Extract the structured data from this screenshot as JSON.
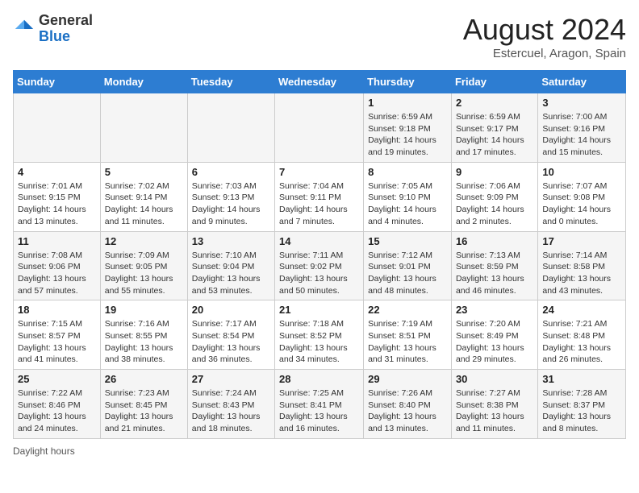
{
  "header": {
    "logo_general": "General",
    "logo_blue": "Blue",
    "month_year": "August 2024",
    "location": "Estercuel, Aragon, Spain"
  },
  "weekdays": [
    "Sunday",
    "Monday",
    "Tuesday",
    "Wednesday",
    "Thursday",
    "Friday",
    "Saturday"
  ],
  "weeks": [
    [
      {
        "day": "",
        "info": ""
      },
      {
        "day": "",
        "info": ""
      },
      {
        "day": "",
        "info": ""
      },
      {
        "day": "",
        "info": ""
      },
      {
        "day": "1",
        "info": "Sunrise: 6:59 AM\nSunset: 9:18 PM\nDaylight: 14 hours and 19 minutes."
      },
      {
        "day": "2",
        "info": "Sunrise: 6:59 AM\nSunset: 9:17 PM\nDaylight: 14 hours and 17 minutes."
      },
      {
        "day": "3",
        "info": "Sunrise: 7:00 AM\nSunset: 9:16 PM\nDaylight: 14 hours and 15 minutes."
      }
    ],
    [
      {
        "day": "4",
        "info": "Sunrise: 7:01 AM\nSunset: 9:15 PM\nDaylight: 14 hours and 13 minutes."
      },
      {
        "day": "5",
        "info": "Sunrise: 7:02 AM\nSunset: 9:14 PM\nDaylight: 14 hours and 11 minutes."
      },
      {
        "day": "6",
        "info": "Sunrise: 7:03 AM\nSunset: 9:13 PM\nDaylight: 14 hours and 9 minutes."
      },
      {
        "day": "7",
        "info": "Sunrise: 7:04 AM\nSunset: 9:11 PM\nDaylight: 14 hours and 7 minutes."
      },
      {
        "day": "8",
        "info": "Sunrise: 7:05 AM\nSunset: 9:10 PM\nDaylight: 14 hours and 4 minutes."
      },
      {
        "day": "9",
        "info": "Sunrise: 7:06 AM\nSunset: 9:09 PM\nDaylight: 14 hours and 2 minutes."
      },
      {
        "day": "10",
        "info": "Sunrise: 7:07 AM\nSunset: 9:08 PM\nDaylight: 14 hours and 0 minutes."
      }
    ],
    [
      {
        "day": "11",
        "info": "Sunrise: 7:08 AM\nSunset: 9:06 PM\nDaylight: 13 hours and 57 minutes."
      },
      {
        "day": "12",
        "info": "Sunrise: 7:09 AM\nSunset: 9:05 PM\nDaylight: 13 hours and 55 minutes."
      },
      {
        "day": "13",
        "info": "Sunrise: 7:10 AM\nSunset: 9:04 PM\nDaylight: 13 hours and 53 minutes."
      },
      {
        "day": "14",
        "info": "Sunrise: 7:11 AM\nSunset: 9:02 PM\nDaylight: 13 hours and 50 minutes."
      },
      {
        "day": "15",
        "info": "Sunrise: 7:12 AM\nSunset: 9:01 PM\nDaylight: 13 hours and 48 minutes."
      },
      {
        "day": "16",
        "info": "Sunrise: 7:13 AM\nSunset: 8:59 PM\nDaylight: 13 hours and 46 minutes."
      },
      {
        "day": "17",
        "info": "Sunrise: 7:14 AM\nSunset: 8:58 PM\nDaylight: 13 hours and 43 minutes."
      }
    ],
    [
      {
        "day": "18",
        "info": "Sunrise: 7:15 AM\nSunset: 8:57 PM\nDaylight: 13 hours and 41 minutes."
      },
      {
        "day": "19",
        "info": "Sunrise: 7:16 AM\nSunset: 8:55 PM\nDaylight: 13 hours and 38 minutes."
      },
      {
        "day": "20",
        "info": "Sunrise: 7:17 AM\nSunset: 8:54 PM\nDaylight: 13 hours and 36 minutes."
      },
      {
        "day": "21",
        "info": "Sunrise: 7:18 AM\nSunset: 8:52 PM\nDaylight: 13 hours and 34 minutes."
      },
      {
        "day": "22",
        "info": "Sunrise: 7:19 AM\nSunset: 8:51 PM\nDaylight: 13 hours and 31 minutes."
      },
      {
        "day": "23",
        "info": "Sunrise: 7:20 AM\nSunset: 8:49 PM\nDaylight: 13 hours and 29 minutes."
      },
      {
        "day": "24",
        "info": "Sunrise: 7:21 AM\nSunset: 8:48 PM\nDaylight: 13 hours and 26 minutes."
      }
    ],
    [
      {
        "day": "25",
        "info": "Sunrise: 7:22 AM\nSunset: 8:46 PM\nDaylight: 13 hours and 24 minutes."
      },
      {
        "day": "26",
        "info": "Sunrise: 7:23 AM\nSunset: 8:45 PM\nDaylight: 13 hours and 21 minutes."
      },
      {
        "day": "27",
        "info": "Sunrise: 7:24 AM\nSunset: 8:43 PM\nDaylight: 13 hours and 18 minutes."
      },
      {
        "day": "28",
        "info": "Sunrise: 7:25 AM\nSunset: 8:41 PM\nDaylight: 13 hours and 16 minutes."
      },
      {
        "day": "29",
        "info": "Sunrise: 7:26 AM\nSunset: 8:40 PM\nDaylight: 13 hours and 13 minutes."
      },
      {
        "day": "30",
        "info": "Sunrise: 7:27 AM\nSunset: 8:38 PM\nDaylight: 13 hours and 11 minutes."
      },
      {
        "day": "31",
        "info": "Sunrise: 7:28 AM\nSunset: 8:37 PM\nDaylight: 13 hours and 8 minutes."
      }
    ]
  ],
  "footer": {
    "note": "Daylight hours"
  }
}
